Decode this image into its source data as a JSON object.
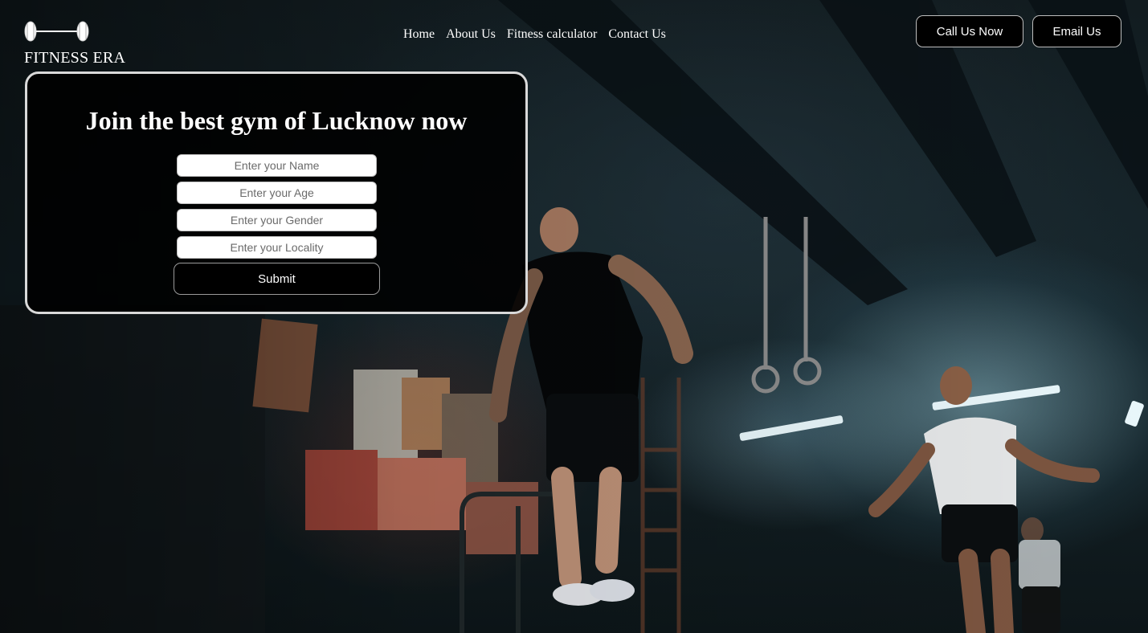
{
  "brand": {
    "name": "FITNESS ERA",
    "logo_icon": "dumbbell-icon"
  },
  "nav": {
    "items": [
      {
        "label": "Home"
      },
      {
        "label": "About Us"
      },
      {
        "label": "Fitness calculator"
      },
      {
        "label": "Contact Us"
      }
    ]
  },
  "actions": {
    "call_label": "Call Us Now",
    "email_label": "Email Us"
  },
  "join_form": {
    "title": "Join the best gym of Lucknow now",
    "fields": [
      {
        "placeholder": "Enter your Name",
        "value": ""
      },
      {
        "placeholder": "Enter your Age",
        "value": ""
      },
      {
        "placeholder": "Enter your Gender",
        "value": ""
      },
      {
        "placeholder": "Enter your Locality",
        "value": ""
      }
    ],
    "submit_label": "Submit"
  },
  "colors": {
    "text": "#ffffff",
    "button_bg": "#000000",
    "card_border": "#d9d9d9"
  }
}
